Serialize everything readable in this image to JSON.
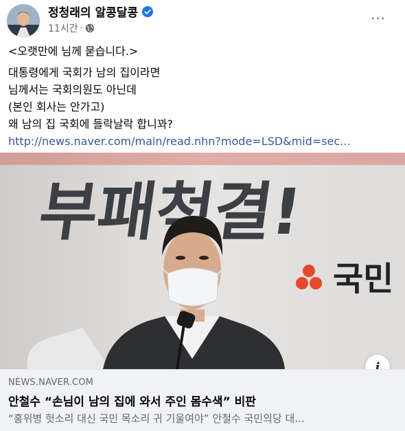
{
  "post": {
    "author": "정청래의 알콩달콩",
    "time": "11시간",
    "separator": "·",
    "more_label": "···",
    "text_lines": [
      "<오랫만에 님께 묻습니다.>",
      "대통령에게 국회가 남의 집이라면",
      "님께서는 국회의원도 아닌데",
      "(본인 회사는 안가고)",
      "왜 남의 집 국회에 들락날락 합니꽈?"
    ],
    "link": "http://news.naver.com/main/read.nhn?mode=LSD&mid=sec..."
  },
  "preview": {
    "banner_text": "부패척결!",
    "party_text": "국민",
    "info_label": "i"
  },
  "link_card": {
    "domain": "NEWS.NAVER.COM",
    "headline": "안철수 “손님이 남의 집에 와서 주인 몸수색” 비판",
    "description": "“홍위병 헛소리 대신 국민 목소리 귀 기울여야” 안철수 국민의당 대..."
  },
  "colors": {
    "verified": "#1877f2",
    "link": "#385898",
    "party_red": "#e8472b",
    "card_bg": "#f0f2f5"
  },
  "icons": [
    "verified-badge-icon",
    "globe-icon",
    "more-options-icon",
    "info-icon"
  ]
}
